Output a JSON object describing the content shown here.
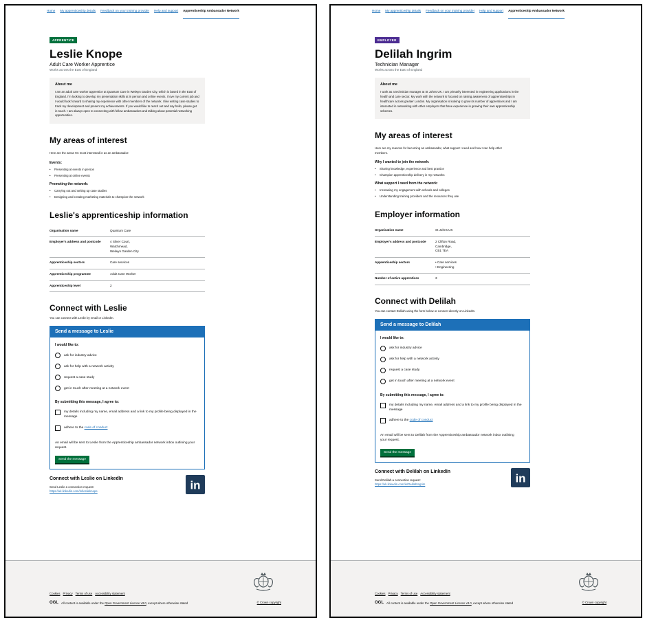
{
  "nav": [
    "Home",
    "My apprenticeship details",
    "Feedback on your training provider",
    "Help and support",
    "Apprenticeship Ambassador Network"
  ],
  "left": {
    "tag": "APPRENTICE",
    "name": "Leslie Knope",
    "role": "Adult Care Worker Apprentice",
    "works": "Works across the East of England",
    "about_title": "About me",
    "about_text": "I am an adult care worker apprentice at Quantum Care in Welwyn Garden City, which is based in the East of England. I'm looking to develop my presentation skills at in person and online events. I love my current job and I would look forward to sharing my experience with other members of the network. I like writing case studies to track my development and present my achievements. If you would like to reach out and say hello, please get in touch. I am always open to connecting with fellow ambassadors and talking about potential networking opportunities.",
    "interests_title": "My areas of interest",
    "interests_intro": "Here are the areas I'm most interested in as an ambassador:",
    "groups": [
      {
        "title": "Events:",
        "items": [
          "Presenting at events in person",
          "Presenting at online events"
        ]
      },
      {
        "title": "Promoting the network:",
        "items": [
          "Carrying out and writing up case studies",
          "Designing and creating marketing materials to champion the network"
        ]
      }
    ],
    "info_title": "Leslie's apprenticeship information",
    "info_rows": [
      {
        "k": "Organisation name",
        "v": [
          "Quantum Care"
        ]
      },
      {
        "k": "Employer's address and postcode",
        "v": [
          "4 Silver Court,",
          "Watchmead,",
          "Welwyn Garden City"
        ]
      },
      {
        "k": "Apprenticeship sectors",
        "v": [
          "Care services"
        ]
      },
      {
        "k": "Apprenticeship programme",
        "v": [
          "Adult Care Worker"
        ]
      },
      {
        "k": "Apprenticeship level",
        "v": [
          "2"
        ]
      }
    ],
    "connect_title": "Connect with Leslie",
    "connect_sub": "You can connect with Leslie by email or LinkedIn.",
    "msg_header": "Send a message to Leslie",
    "like_label": "I would like to:",
    "options": [
      "ask for industry advice",
      "ask for help with a network activity",
      "request a case study",
      "get in touch after meeting at a network event"
    ],
    "agree_label": "By submitting this message, I agree to:",
    "check1": "my details including my name, email address and a link to my profile being displayed in the message",
    "check2_pre": "adhere to the ",
    "check2_link": "code of conduct",
    "note": "An email will be sent to Leslie from the Apprenticeship ambassador network inbox outlining your request.",
    "send": "Send the message",
    "li_title": "Connect with Leslie on LinkedIn",
    "li_req": "Send Leslie a connection request:",
    "li_url": "https://uk.linkedin.com/in/leslieknope"
  },
  "right": {
    "tag": "EMPLOYER",
    "name": "Delilah Ingrim",
    "role": "Technician Manager",
    "works": "Works across the East of England",
    "about_title": "About me",
    "about_text": "I work as a technician manager at St Johns UK. I am primarily interested in engineering applications in the health and care sector. My work with the network is focused on raising awareness of apprenticeships in healthcare across greater London. My organisation is looking to grow its number of apprentices and I am interested in networking with other employers that have experience in growing their own apprenticeship schemes.",
    "interests_title": "My areas of interest",
    "interests_intro": "Here are my reasons for becoming an ambassador, what support I need and how I can help other members.",
    "groups": [
      {
        "title": "Why I wanted to join the network:",
        "items": [
          "Sharing knowledge, experience and best practice",
          "Champion apprenticeship delivery in my networks"
        ]
      },
      {
        "title": "What support I need from the network:",
        "items": [
          "Increasing my engagement with schools and colleges",
          "Understanding training providers and the resources they use"
        ]
      }
    ],
    "info_title": "Employer information",
    "info_rows": [
      {
        "k": "Organisation name",
        "v": [
          "St Johns UK"
        ]
      },
      {
        "k": "Employer's address and postcode",
        "v": [
          "2 Clifton Road,",
          "Cambridge,",
          "CB1 7EA"
        ]
      },
      {
        "k": "Apprenticeship sectors",
        "v": [
          "• Care services",
          "• Engineering"
        ]
      },
      {
        "k": "Number of active apprentices",
        "v": [
          "3"
        ]
      }
    ],
    "connect_title": "Connect with Delilah",
    "connect_sub": "You can contact Delilah using the form below or connect directly on LinkedIn.",
    "msg_header": "Send a message to Delilah",
    "like_label": "I would like to:",
    "options": [
      "ask for industry advice",
      "ask for help with a network activity",
      "request a case study",
      "get in touch after meeting at a network event"
    ],
    "agree_label": "By submitting this message, I agree to:",
    "check1": "my details including my name, email address and a link to my profile being displayed in the message",
    "check2_pre": "adhere to the ",
    "check2_link": "code of conduct",
    "note": "An email will be sent to Delilah from the Apprenticeship ambassador network inbox outlining your request.",
    "send": "Send the message",
    "li_title": "Connect with Delilah on LinkedIn",
    "li_req": "Send Delilah a connection request:",
    "li_url": "https://uk.linkedin.com/in/DelilahIngrim"
  },
  "footer": {
    "links": [
      "Cookies",
      "Privacy",
      "Terms of use",
      "Accessibility statement"
    ],
    "ogl_mark": "OGL",
    "ogl_pre": "All content is available under the ",
    "ogl_link": "Open Government Licence v3.0",
    "ogl_post": ", except where otherwise stated",
    "crown": "© Crown copyright"
  },
  "li_logo_text": "in",
  "colors": {
    "blue": "#1d70b8",
    "green": "#00703c",
    "purple": "#4c2c92",
    "linkedin": "#1f3b5a"
  }
}
